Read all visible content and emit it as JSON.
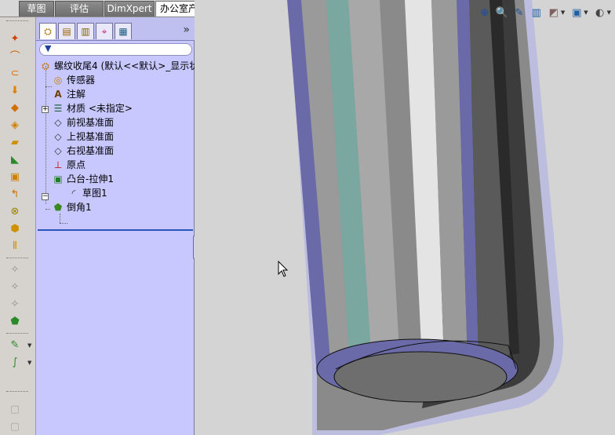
{
  "command_tabs": [
    "草图",
    "评估",
    "DimXpert",
    "办公室产品"
  ],
  "active_tab": "办公室产品",
  "feature_manager": {
    "tabs": [
      "feature-manager-tab",
      "property-manager-tab",
      "configuration-manager-tab",
      "dimxpert-manager-tab",
      "display-manager-tab"
    ],
    "more": "»",
    "tree": {
      "root": "螺纹收尾4  (默认<<默认>_显示状",
      "items": [
        {
          "label": "传感器",
          "icon": "sensor-icon"
        },
        {
          "label": "注解",
          "icon": "annotation-icon"
        },
        {
          "label": "材质 <未指定>",
          "icon": "material-icon"
        },
        {
          "label": "前视基准面",
          "icon": "plane-icon"
        },
        {
          "label": "上视基准面",
          "icon": "plane-icon"
        },
        {
          "label": "右视基准面",
          "icon": "plane-icon"
        },
        {
          "label": "原点",
          "icon": "origin-icon"
        },
        {
          "label": "凸台-拉伸1",
          "icon": "extrude-icon"
        },
        {
          "label": "草图1",
          "icon": "sketch-icon"
        },
        {
          "label": "倒角1",
          "icon": "chamfer-icon"
        }
      ]
    }
  },
  "colors": {
    "panel": "#c8c8ff",
    "rollback_bar": "#2a58b8",
    "viewport": "#d4d4d4",
    "edge_highlight": "#5a5a9a",
    "cylinder_dark": "#3a3a3a"
  }
}
